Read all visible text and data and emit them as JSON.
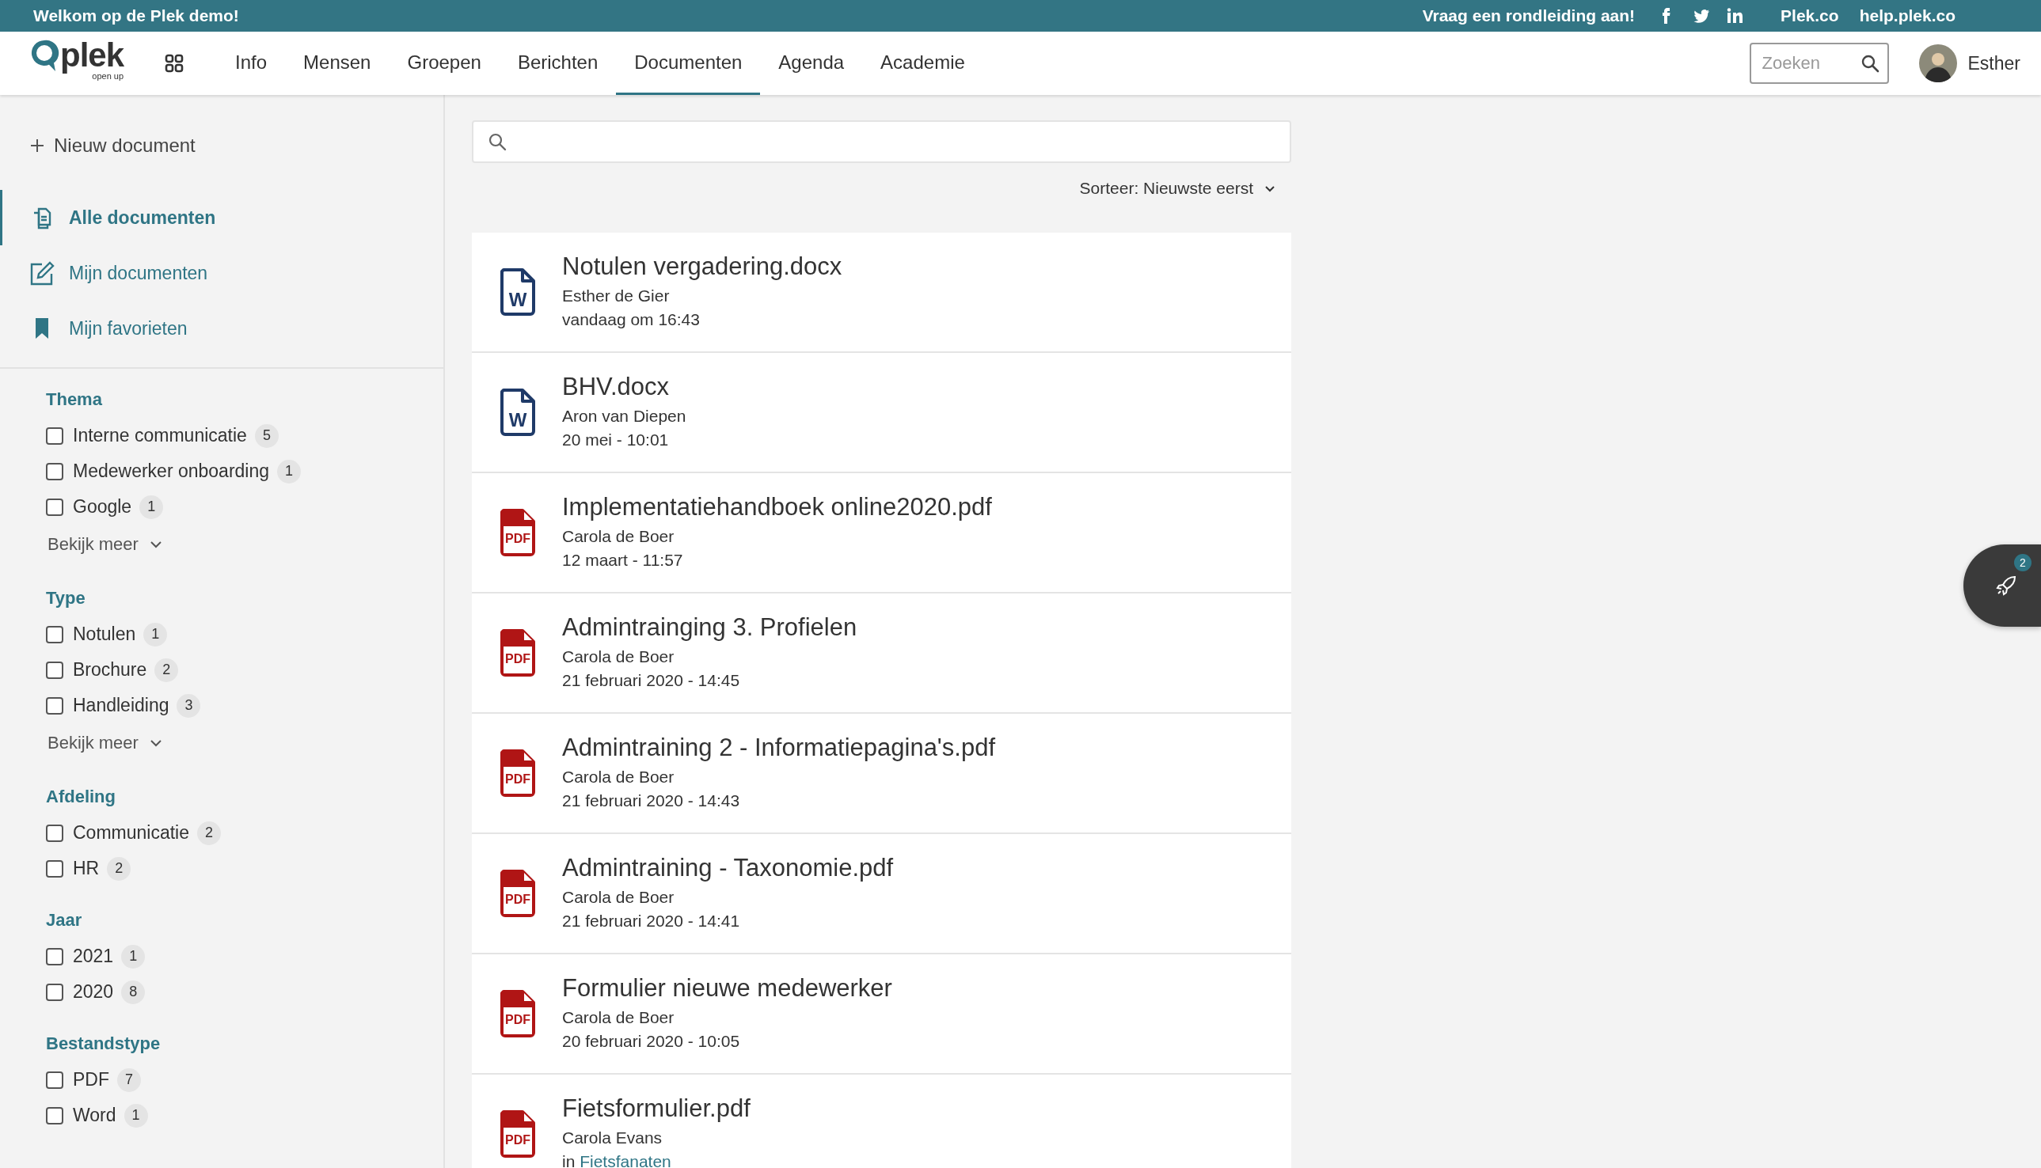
{
  "announcement_bar": {
    "welcome": "Welkom op de Plek demo!",
    "tour_link": "Vraag een rondleiding aan!",
    "social": [
      {
        "kind": "facebook"
      },
      {
        "kind": "twitter"
      },
      {
        "kind": "linkedin"
      }
    ],
    "links": [
      "Plek.co",
      "help.plek.co"
    ]
  },
  "header": {
    "logo": {
      "text": "plek",
      "tagline": "open up"
    },
    "nav": [
      {
        "label": "Info",
        "selected": false
      },
      {
        "label": "Mensen",
        "selected": false
      },
      {
        "label": "Groepen",
        "selected": false
      },
      {
        "label": "Berichten",
        "selected": false
      },
      {
        "label": "Documenten",
        "selected": true
      },
      {
        "label": "Agenda",
        "selected": false
      },
      {
        "label": "Academie",
        "selected": false
      }
    ],
    "search": {
      "placeholder": "Zoeken"
    },
    "user": {
      "name": "Esther"
    }
  },
  "sidebar": {
    "new_button": "Nieuw document",
    "items": [
      {
        "label": "Alle documenten",
        "kind": "documents",
        "selected": true
      },
      {
        "label": "Mijn documenten",
        "kind": "edit",
        "selected": false
      },
      {
        "label": "Mijn favorieten",
        "kind": "bookmark",
        "selected": false
      }
    ],
    "filters": [
      {
        "title": "Thema",
        "options": [
          {
            "label": "Interne communicatie",
            "count": "5",
            "checked": false
          },
          {
            "label": "Medewerker onboarding",
            "count": "1",
            "checked": false
          },
          {
            "label": "Google",
            "count": "1",
            "checked": false
          }
        ],
        "more": "Bekijk meer"
      },
      {
        "title": "Type",
        "options": [
          {
            "label": "Notulen",
            "count": "1",
            "checked": false
          },
          {
            "label": "Brochure",
            "count": "2",
            "checked": false
          },
          {
            "label": "Handleiding",
            "count": "3",
            "checked": false
          }
        ],
        "more": "Bekijk meer"
      },
      {
        "title": "Afdeling",
        "options": [
          {
            "label": "Communicatie",
            "count": "2",
            "checked": false
          },
          {
            "label": "HR",
            "count": "2",
            "checked": false
          }
        ]
      },
      {
        "title": "Jaar",
        "options": [
          {
            "label": "2021",
            "count": "1",
            "checked": false
          },
          {
            "label": "2020",
            "count": "8",
            "checked": false
          }
        ]
      },
      {
        "title": "Bestandstype",
        "options": [
          {
            "label": "PDF",
            "count": "7",
            "checked": false
          },
          {
            "label": "Word",
            "count": "1",
            "checked": false
          }
        ]
      }
    ]
  },
  "documents": {
    "sort": "Sorteer: Nieuwste eerst",
    "rows": [
      {
        "kind": "word",
        "icon_text": "W",
        "title": "Notulen vergadering.docx",
        "author": "Esther de Gier",
        "date": "vandaag om 16:43"
      },
      {
        "kind": "word",
        "icon_text": "W",
        "title": "BHV.docx",
        "author": "Aron van Diepen",
        "date": "20 mei - 10:01"
      },
      {
        "kind": "pdf",
        "icon_text": "PDF",
        "title": "Implementatiehandboek online2020.pdf",
        "author": "Carola de Boer",
        "date": "12 maart - 11:57"
      },
      {
        "kind": "pdf",
        "icon_text": "PDF",
        "title": "Admintrainging 3. Profielen",
        "author": "Carola de Boer",
        "date": "21 februari 2020 - 14:45"
      },
      {
        "kind": "pdf",
        "icon_text": "PDF",
        "title": "Admintraining 2 - Informatiepagina's.pdf",
        "author": "Carola de Boer",
        "date": "21 februari 2020 - 14:43"
      },
      {
        "kind": "pdf",
        "icon_text": "PDF",
        "title": "Admintraining - Taxonomie.pdf",
        "author": "Carola de Boer",
        "date": "21 februari 2020 - 14:41"
      },
      {
        "kind": "pdf",
        "icon_text": "PDF",
        "title": "Formulier nieuwe medewerker",
        "author": "Carola de Boer",
        "date": "20 februari 2020 - 10:05"
      },
      {
        "kind": "pdf",
        "icon_text": "PDF",
        "title": "Fietsformulier.pdf",
        "author": "Carola Evans",
        "group_prefix": "in",
        "group": "Fietsfanaten"
      }
    ]
  },
  "launcher": {
    "badge": "2"
  }
}
